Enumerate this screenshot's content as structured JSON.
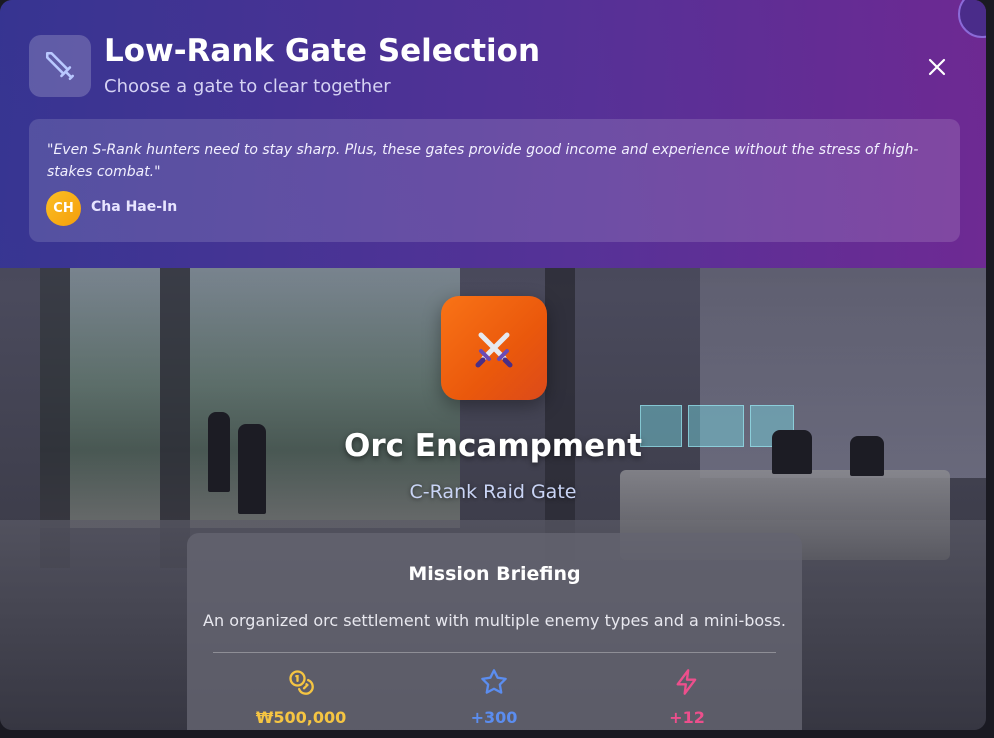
{
  "header": {
    "title": "Low-Rank Gate Selection",
    "subtitle": "Choose a gate to clear together",
    "icon": "sword-icon",
    "close_icon": "close-icon"
  },
  "quote": {
    "text": "\"Even S-Rank hunters need to stay sharp. Plus, these gates provide good income and experience without the stress of high-stakes combat.\"",
    "speaker_initials": "CH",
    "speaker_name": "Cha Hae-In"
  },
  "gate": {
    "icon": "crossed-swords-icon",
    "name": "Orc Encampment",
    "rank": "C-Rank Raid Gate"
  },
  "mission": {
    "title": "Mission Briefing",
    "description": "An organized orc settlement with multiple enemy types and a mini-boss.",
    "rewards": [
      {
        "icon": "coins-icon",
        "value": "₩500,000",
        "color": "#f5c542"
      },
      {
        "icon": "star-icon",
        "value": "+300",
        "color": "#5b8def"
      },
      {
        "icon": "lightning-icon",
        "value": "+12",
        "color": "#ec4f8c"
      }
    ]
  },
  "colors": {
    "header_start": "#36349a",
    "header_end": "#70289a",
    "gate_icon": "#f97316",
    "avatar": "#f59e0b"
  }
}
